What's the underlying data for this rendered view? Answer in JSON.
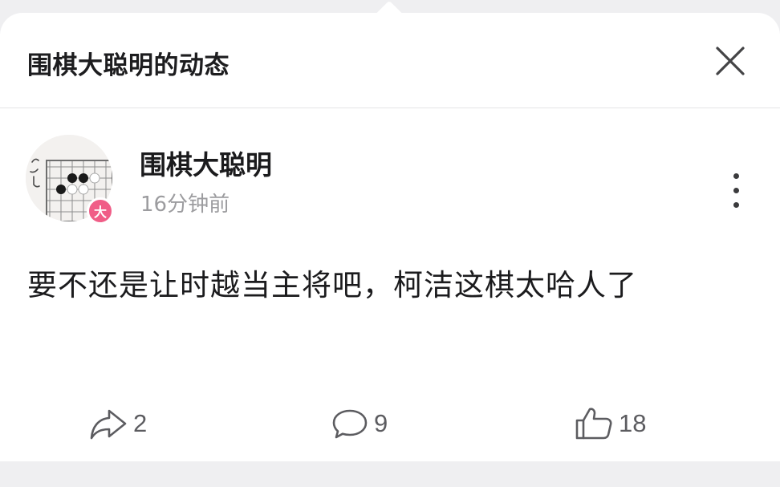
{
  "header": {
    "title": "围棋大聪明的动态"
  },
  "post": {
    "author": "围棋大聪明",
    "avatar_badge": "大",
    "time": "16分钟前",
    "content": "要不还是让时越当主将吧，柯洁这棋太哈人了"
  },
  "actions": {
    "share_count": "2",
    "comment_count": "9",
    "like_count": "18"
  },
  "icons": {
    "close": "close-icon",
    "more": "more-vertical-icon",
    "share": "share-icon",
    "comment": "comment-icon",
    "like": "thumbs-up-icon"
  },
  "colors": {
    "badge": "#f05d87",
    "background": "#efeff1"
  }
}
